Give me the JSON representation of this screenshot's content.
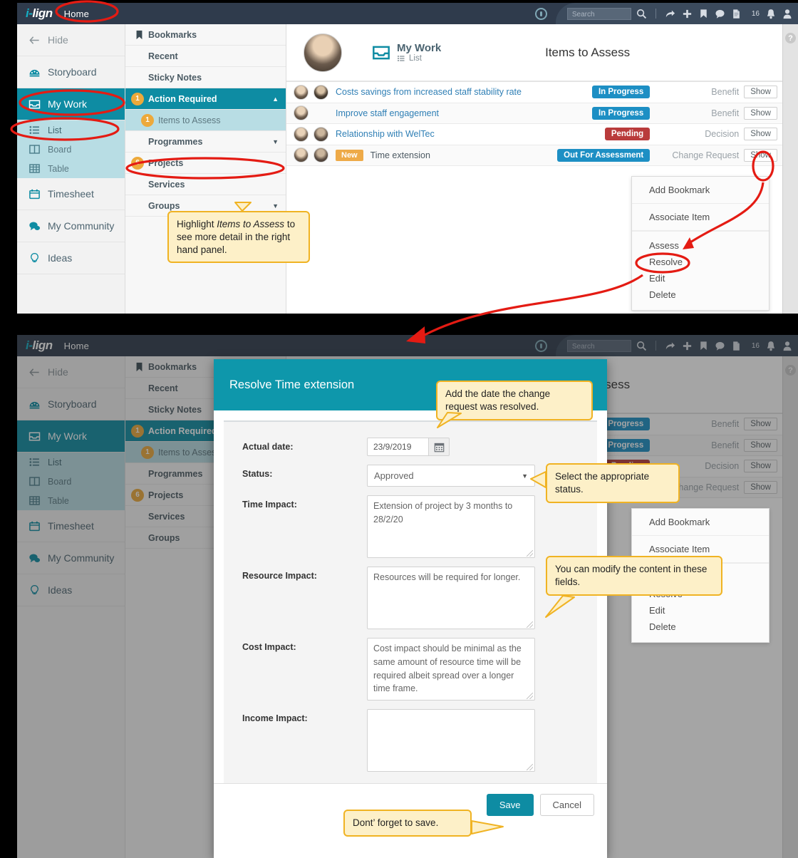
{
  "topbar": {
    "logo_i": "i",
    "logo_dash": "-",
    "logo_lign": "lign",
    "home": "Home",
    "search_placeholder": "Search",
    "notification_count": "16",
    "icons": [
      "globe-icon",
      "search-icon",
      "share-icon",
      "plus-icon",
      "bookmark-icon",
      "comment-icon",
      "document-icon",
      "bell-icon",
      "user-icon"
    ]
  },
  "leftnav": {
    "hide": "Hide",
    "items": [
      {
        "label": "Storyboard",
        "icon": "speedometer-icon"
      },
      {
        "label": "My Work",
        "icon": "inbox-icon"
      },
      {
        "label": "Timesheet",
        "icon": "calendar-icon"
      },
      {
        "label": "My Community",
        "icon": "chat-icon"
      },
      {
        "label": "Ideas",
        "icon": "lightbulb-icon"
      }
    ],
    "subitems": [
      {
        "label": "List",
        "icon": "list-icon"
      },
      {
        "label": "Board",
        "icon": "board-icon"
      },
      {
        "label": "Table",
        "icon": "table-icon"
      }
    ]
  },
  "midpanel": {
    "items": [
      {
        "label": "Bookmarks",
        "badge": "",
        "icon": "bookmark-icon"
      },
      {
        "label": "Recent",
        "badge": ""
      },
      {
        "label": "Sticky Notes",
        "badge": ""
      },
      {
        "label": "Action Required",
        "badge": "1",
        "caret": "▲"
      },
      {
        "label": "Items to Assess",
        "badge": "1"
      },
      {
        "label": "Programmes",
        "badge": "",
        "caret": "▼"
      },
      {
        "label": "Projects",
        "badge": "6"
      },
      {
        "label": "Services",
        "badge": ""
      },
      {
        "label": "Groups",
        "badge": "",
        "caret": "▼"
      }
    ]
  },
  "mainhead": {
    "context_title": "My Work",
    "context_sub": "List",
    "page_title": "Items to Assess"
  },
  "rows": [
    {
      "title": "Costs savings from increased staff stability rate",
      "status": "In Progress",
      "status_color": "blue",
      "type": "Benefit",
      "show": "Show",
      "avatars": 2,
      "new": ""
    },
    {
      "title": "Improve staff engagement",
      "status": "In Progress",
      "status_color": "blue",
      "type": "Benefit",
      "show": "Show",
      "avatars": 1,
      "new": ""
    },
    {
      "title": "Relationship with WelTec",
      "status": "Pending",
      "status_color": "red",
      "type": "Decision",
      "show": "Show",
      "avatars": 2,
      "new": ""
    },
    {
      "title": "Time extension",
      "status": "Out For Assessment",
      "status_color": "blue",
      "type": "Change Request",
      "show": "Show",
      "avatars": 2,
      "new": "New"
    }
  ],
  "dropdown": {
    "items": [
      "Add Bookmark",
      "Associate Item",
      "Assess",
      "Resolve",
      "Edit",
      "Delete"
    ]
  },
  "help": {
    "symbol": "?"
  },
  "callouts": {
    "highlight": {
      "pre": "Highlight ",
      "em": "Items to Assess",
      "post": " to see more detail in the right hand panel."
    },
    "add_date": "Add the date the change request was resolved.",
    "select_status": "Select the appropriate status.",
    "modify_content": "You can modify the content in these fields.",
    "dont_forget": "Dont’ forget to save."
  },
  "modal": {
    "title": "Resolve Time extension",
    "fields": [
      {
        "label": "Actual date:",
        "type": "date",
        "value": "23/9/2019"
      },
      {
        "label": "Status:",
        "type": "select",
        "value": "Approved"
      },
      {
        "label": "Time Impact:",
        "type": "textarea",
        "value": "Extension of project by 3 months to 28/2/20"
      },
      {
        "label": "Resource Impact:",
        "type": "textarea",
        "value": "Resources will be required for longer."
      },
      {
        "label": "Cost Impact:",
        "type": "textarea",
        "value": "Cost impact should be minimal as the same amount of resource time will be required albeit spread over a longer time frame."
      },
      {
        "label": "Income Impact:",
        "type": "textarea",
        "value": ""
      }
    ],
    "save": "Save",
    "cancel": "Cancel"
  },
  "colors": {
    "brand_teal": "#0e8ca3",
    "modal_teal": "#0e97ab",
    "topbar": "#2f3b4c",
    "status_blue": "#1d8fc4",
    "status_red": "#b93b3b",
    "badge_orange": "#eda93b",
    "callout_bg": "#fdf0c8",
    "callout_border": "#f0b323",
    "annotation_red": "#e41b13"
  }
}
